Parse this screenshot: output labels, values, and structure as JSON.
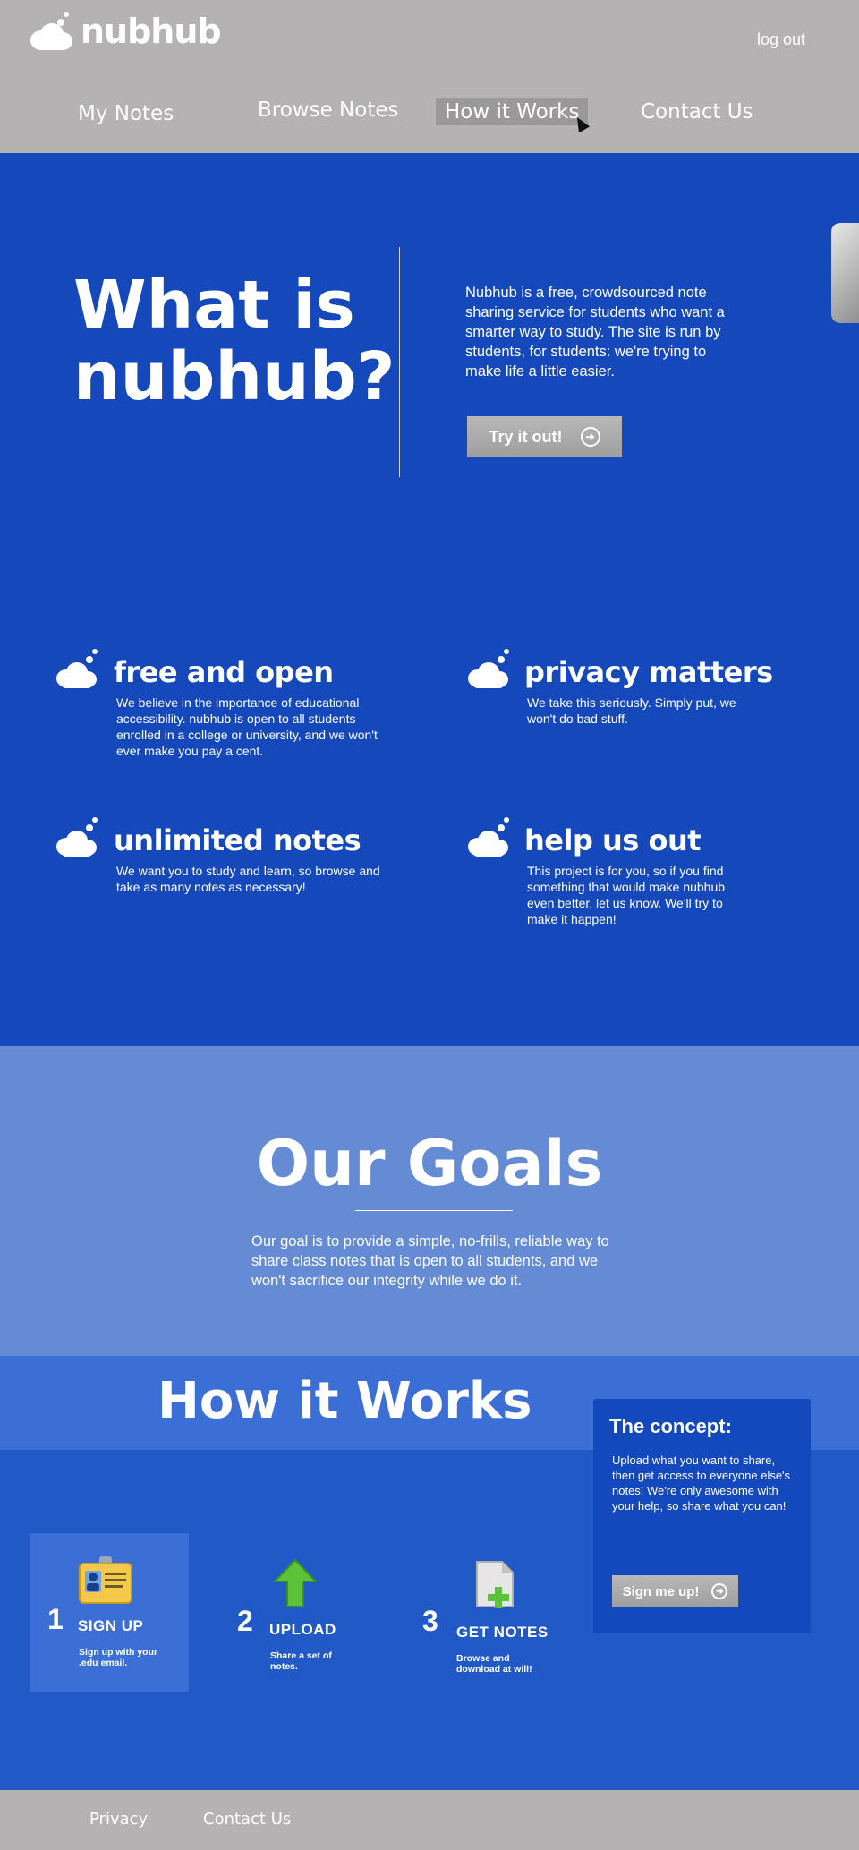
{
  "header": {
    "logo_text": "nubhub",
    "logout_label": "log out",
    "nav": [
      {
        "label": "My Notes"
      },
      {
        "label": "Browse Notes"
      },
      {
        "label": "How it Works",
        "active": true
      },
      {
        "label": "Contact Us"
      }
    ]
  },
  "hero": {
    "title_line1": "What is",
    "title_line2": "nubhub?",
    "text": "Nubhub is a free, crowdsourced note sharing service for students who want a smarter way to study. The site is run by students, for students: we're trying to make life a little easier.",
    "button_label": "Try it out!"
  },
  "features": [
    {
      "title": "free and open",
      "text": "We believe in the importance of educational accessibility. nubhub is open to all students enrolled in a college or university, and we won't ever make you pay a cent."
    },
    {
      "title": "privacy matters",
      "text": "We take this seriously. Simply put, we won't do bad stuff."
    },
    {
      "title": "unlimited notes",
      "text": "We want you to study and learn, so browse and take as many notes as necessary!"
    },
    {
      "title": "help us out",
      "text": "This project is for you, so if you find something that would make nubhub even better, let us know. We'll try to make it happen!"
    }
  ],
  "goals": {
    "title": "Our Goals",
    "text": "Our goal is to provide a simple, no-frills, reliable way to share class notes that is open to all students, and we won't sacrifice our integrity while we do it."
  },
  "how": {
    "title": "How it Works",
    "concept_title": "The concept:",
    "concept_text": "Upload what you want to share, then get access to everyone else's notes! We're only awesome with your help, so share what you can!",
    "concept_button": "Sign me up!",
    "steps": [
      {
        "num": "1",
        "label": "SIGN UP",
        "sub": "Sign up with your .edu email.",
        "icon": "id-card-icon"
      },
      {
        "num": "2",
        "label": "UPLOAD",
        "sub": "Share a set of notes.",
        "icon": "upload-arrow-icon"
      },
      {
        "num": "3",
        "label": "GET NOTES",
        "sub": "Browse and download at will!",
        "icon": "add-document-icon"
      }
    ]
  },
  "footer": {
    "links": [
      {
        "label": "Privacy"
      },
      {
        "label": "Contact Us"
      }
    ]
  },
  "colors": {
    "header_bg": "#b4b2b2",
    "hero_bg": "#1448bb",
    "goals_bg": "#648bd3",
    "how_bg": "#2159c6",
    "concept_bg": "#1449bd"
  }
}
